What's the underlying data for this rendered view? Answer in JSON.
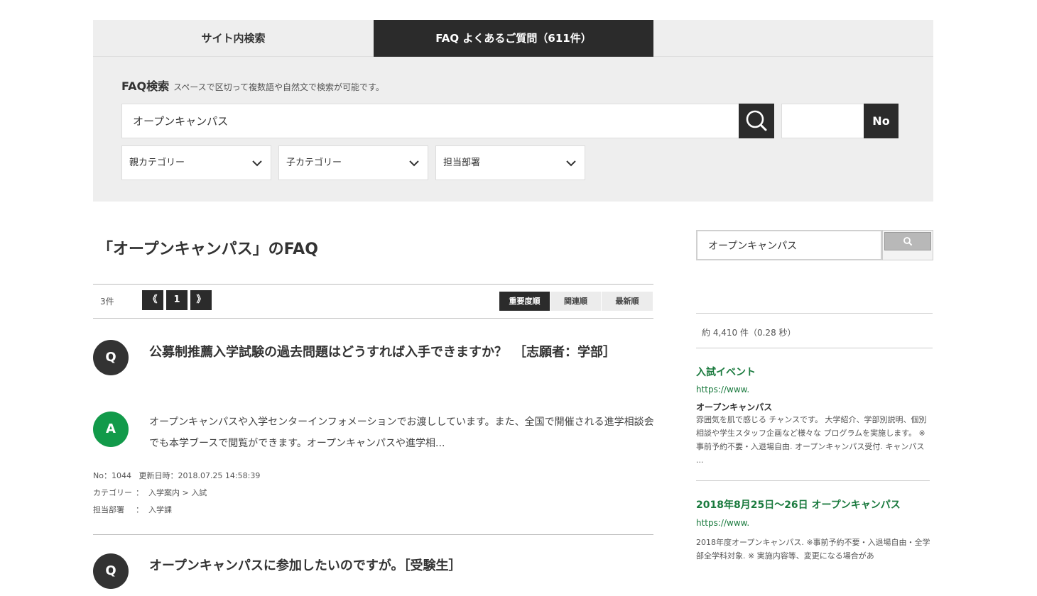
{
  "tabs": [
    {
      "label": "サイト内検索"
    },
    {
      "label": "FAQ よくあるご質問（611件）"
    }
  ],
  "faq_search": {
    "title": "FAQ検索",
    "hint": "スペースで区切って複数語や自然文で検索が可能です。",
    "keyword_value": "オープンキャンパス",
    "no_button_label": "No",
    "selects": [
      {
        "label": "親カテゴリー"
      },
      {
        "label": "子カテゴリー"
      },
      {
        "label": "担当部署"
      }
    ]
  },
  "results": {
    "title": "「オープンキャンパス」のFAQ",
    "count": "3件",
    "pagination": {
      "prev": "《",
      "current": "1",
      "next": "》"
    },
    "sort": [
      "重要度順",
      "関連順",
      "最新順"
    ],
    "items": [
      {
        "question": "公募制推薦入学試験の過去問題はどうすれば入手できますか？　［志願者：学部］",
        "answer": "オープンキャンパスや入学センターインフォメーションでお渡ししています。また、全国で開催される進学相談会でも本学ブースで閲覧ができます。オープンキャンパスや進学相...",
        "meta_no": "No：1044",
        "meta_updated": "更新日時：2018.07.25 14:58:39",
        "category_label": "カテゴリー",
        "category": "入学案内 > 入試",
        "dept_label": "担当部署",
        "dept": "入学課",
        "sep": "："
      },
      {
        "question": "オープンキャンパスに参加したいのですが。［受験生］"
      }
    ],
    "q_badge": "Q",
    "a_badge": "A"
  },
  "sidebar": {
    "search_value": "オープンキャンパス",
    "stats": "約 4,410 件（0.28 秒）",
    "results": [
      {
        "title": "入試イベント",
        "url": "https://www.",
        "subtitle": "オープンキャンパス",
        "snippet": "雰囲気を肌で感じる チャンスです。 大学紹介、学部別説明、個別相談や学生スタッフ企画など様々な プログラムを実施します。 ※事前予約不要・入退場自由. オープンキャンパス受付. キャンパス ..."
      },
      {
        "title": "2018年8月25日〜26日 オープンキャンパス",
        "url": "https://www.",
        "snippet": "2018年度オープンキャンパス. ※事前予約不要・入退場自由・全学部全学科対象. ※ 実施内容等、変更になる場合があ"
      }
    ]
  }
}
